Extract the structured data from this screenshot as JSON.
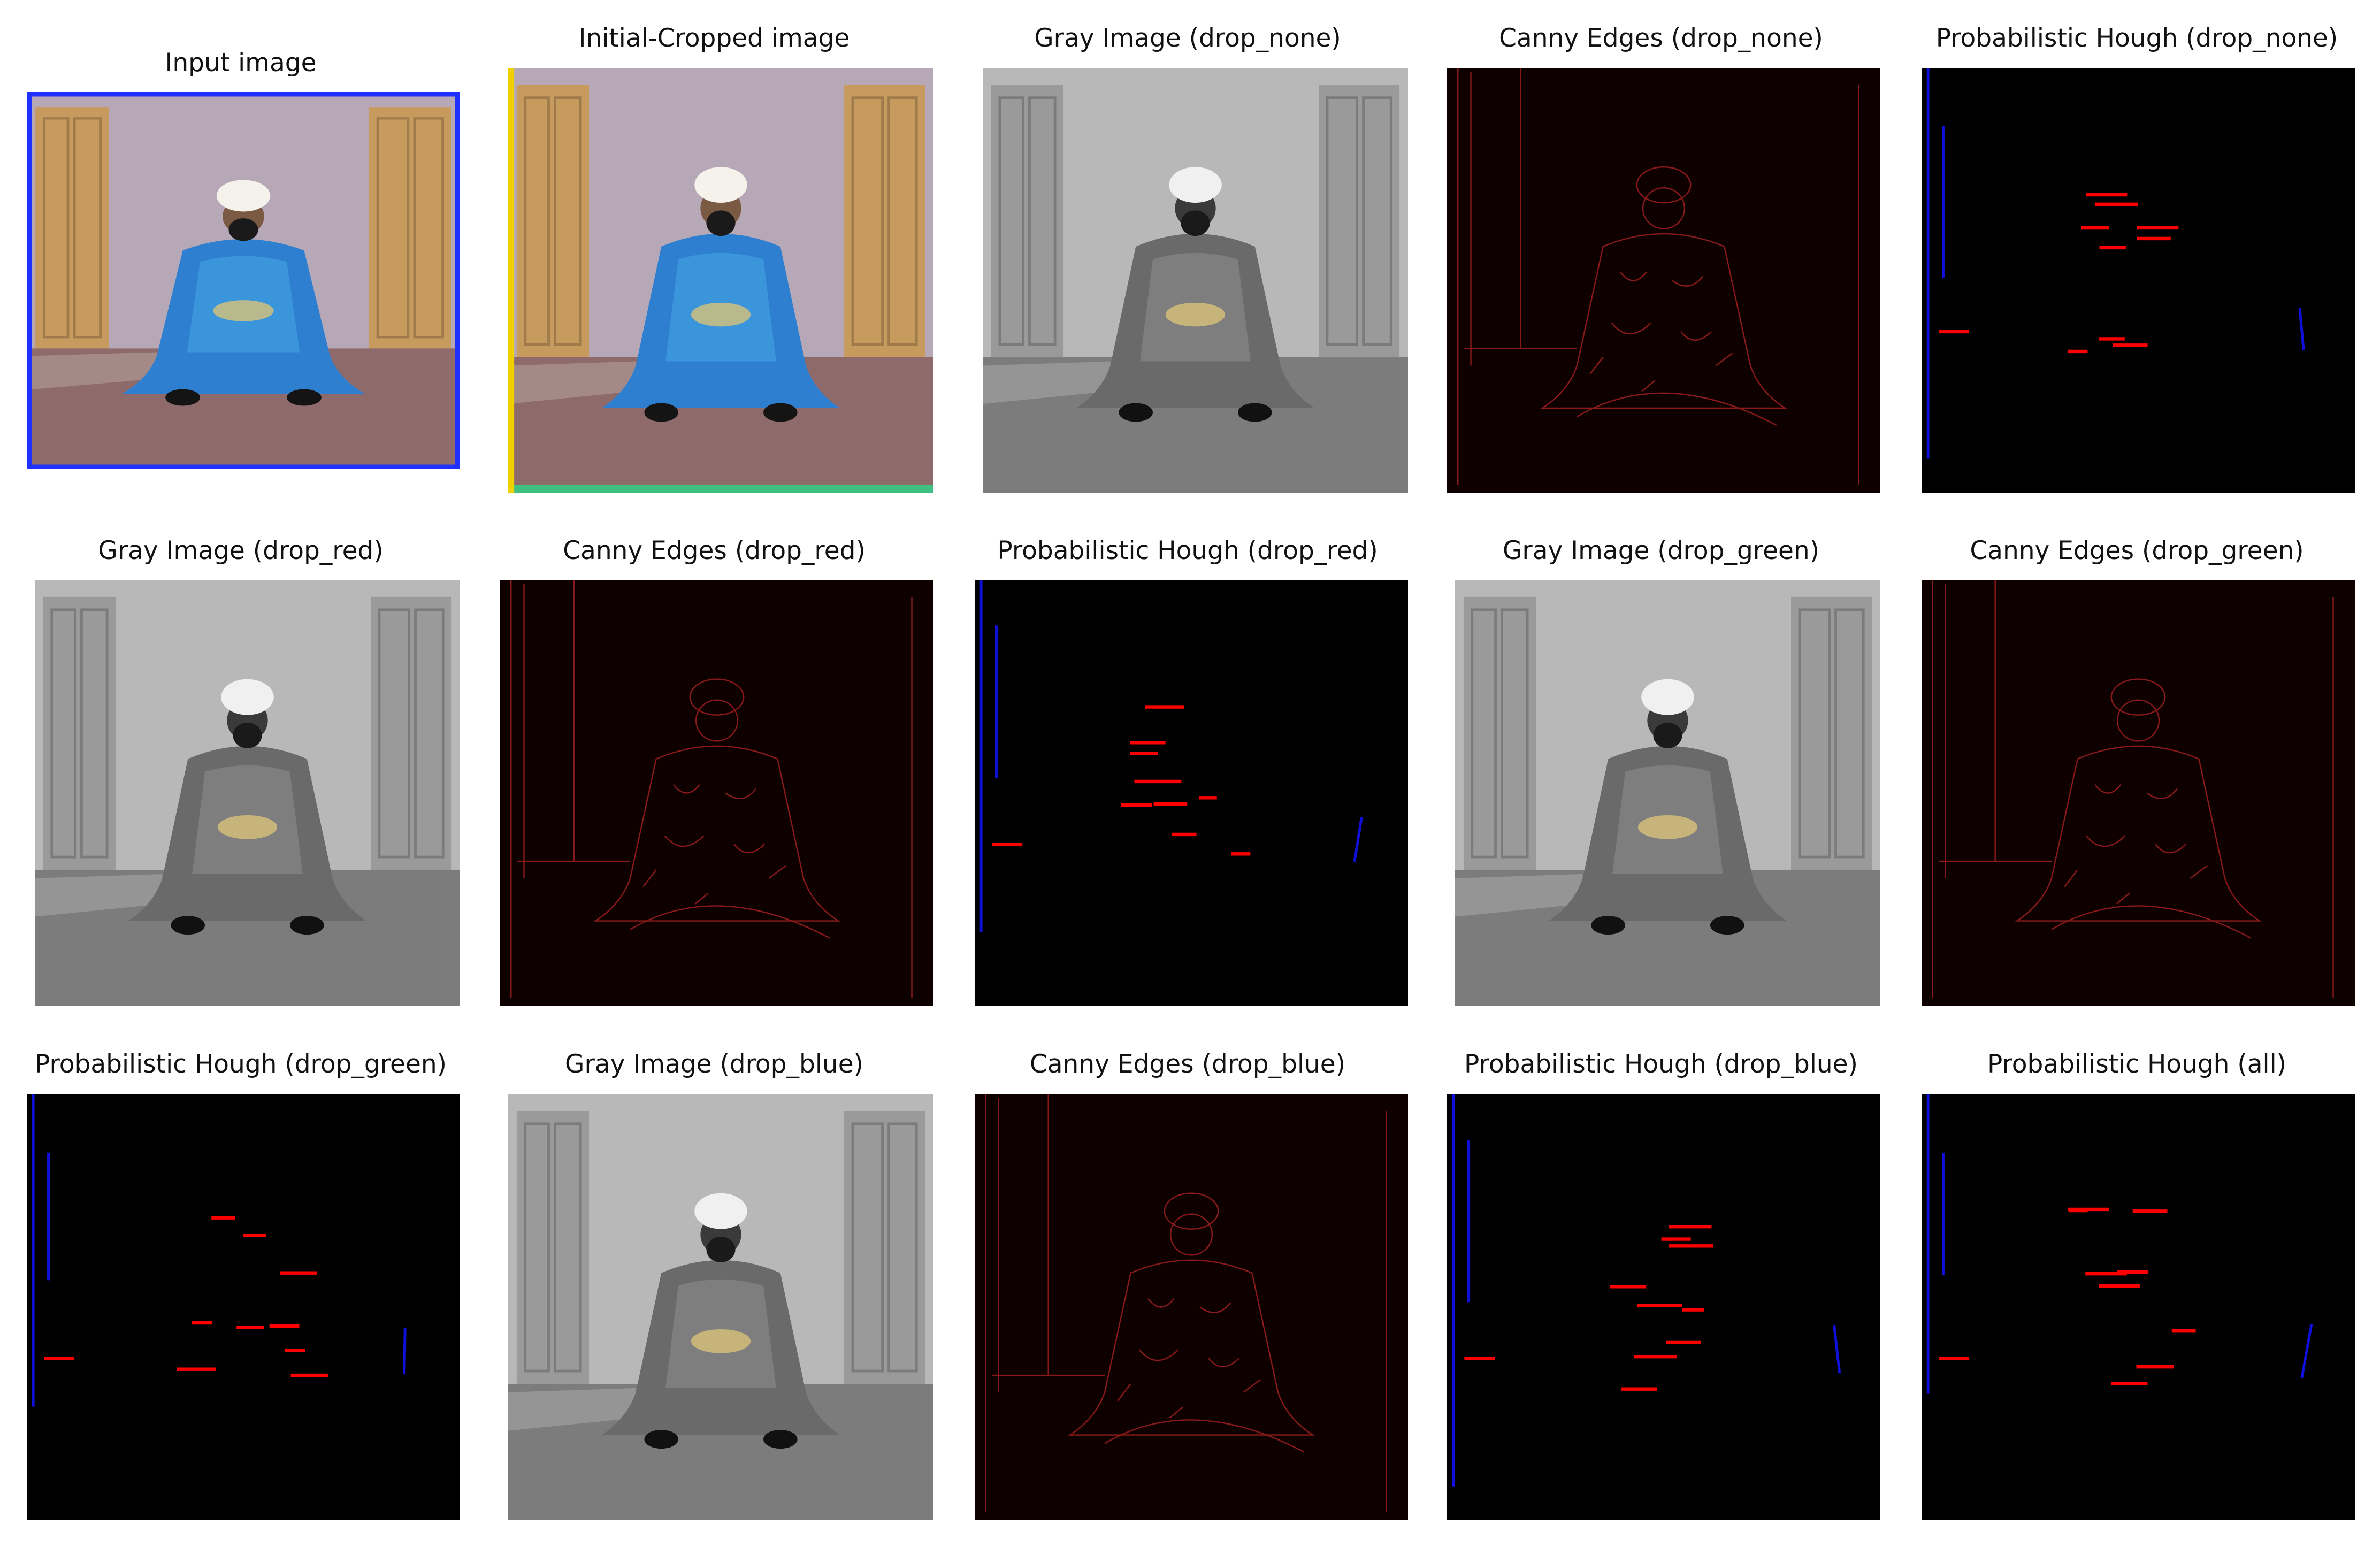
{
  "figure": {
    "panels": [
      {
        "title": "Input image",
        "kind": "color-input"
      },
      {
        "title": "Initial-Cropped image",
        "kind": "color-cropped"
      },
      {
        "title": "Gray Image (drop_none)",
        "kind": "gray"
      },
      {
        "title": "Canny Edges (drop_none)",
        "kind": "canny"
      },
      {
        "title": "Probabilistic Hough (drop_none)",
        "kind": "hough"
      },
      {
        "title": "Gray Image (drop_red)",
        "kind": "gray"
      },
      {
        "title": "Canny Edges (drop_red)",
        "kind": "canny"
      },
      {
        "title": "Probabilistic Hough (drop_red)",
        "kind": "hough"
      },
      {
        "title": "Gray Image (drop_green)",
        "kind": "gray"
      },
      {
        "title": "Canny Edges (drop_green)",
        "kind": "canny"
      },
      {
        "title": "Probabilistic Hough (drop_green)",
        "kind": "hough"
      },
      {
        "title": "Gray Image (drop_blue)",
        "kind": "gray"
      },
      {
        "title": "Canny Edges (drop_blue)",
        "kind": "canny"
      },
      {
        "title": "Probabilistic Hough (drop_blue)",
        "kind": "hough"
      },
      {
        "title": "Probabilistic Hough (all)",
        "kind": "hough"
      }
    ],
    "colors": {
      "background": "#ffffff",
      "hough_background": "#000000",
      "canny_background": "#0f0000",
      "horizontal_lines": "#ff0000",
      "vertical_lines": "#1010dd",
      "canny_edges": "#8a1a1a"
    }
  }
}
